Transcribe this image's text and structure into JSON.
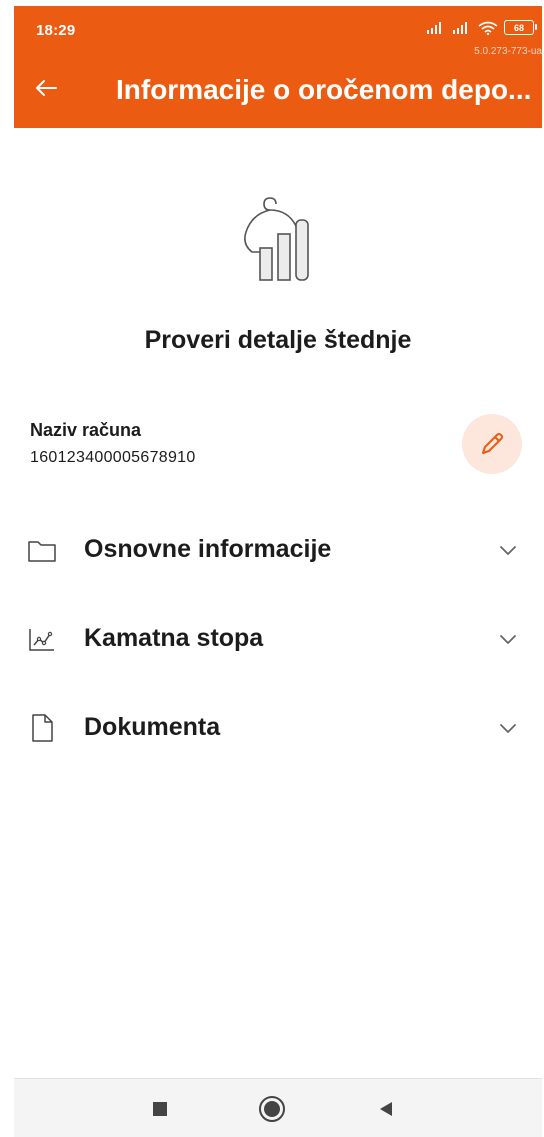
{
  "status_bar": {
    "time": "18:29",
    "battery": "68",
    "version": "5.0.273-773-ua"
  },
  "header": {
    "title": "Informacije o oročenom depo..."
  },
  "main": {
    "title": "Proveri detalje štednje",
    "account": {
      "label": "Naziv računa",
      "number": "160123400005678910"
    },
    "sections": [
      {
        "label": "Osnovne informacije",
        "icon": "folder-icon"
      },
      {
        "label": "Kamatna stopa",
        "icon": "chart-line-icon"
      },
      {
        "label": "Dokumenta",
        "icon": "document-icon"
      }
    ]
  },
  "colors": {
    "accent": "#ec5b12",
    "edit_bg": "#fde6dc",
    "text": "#1c1c1c"
  },
  "navbar": {
    "icons": [
      "recents-square-icon",
      "home-circle-icon",
      "back-triangle-icon"
    ]
  }
}
